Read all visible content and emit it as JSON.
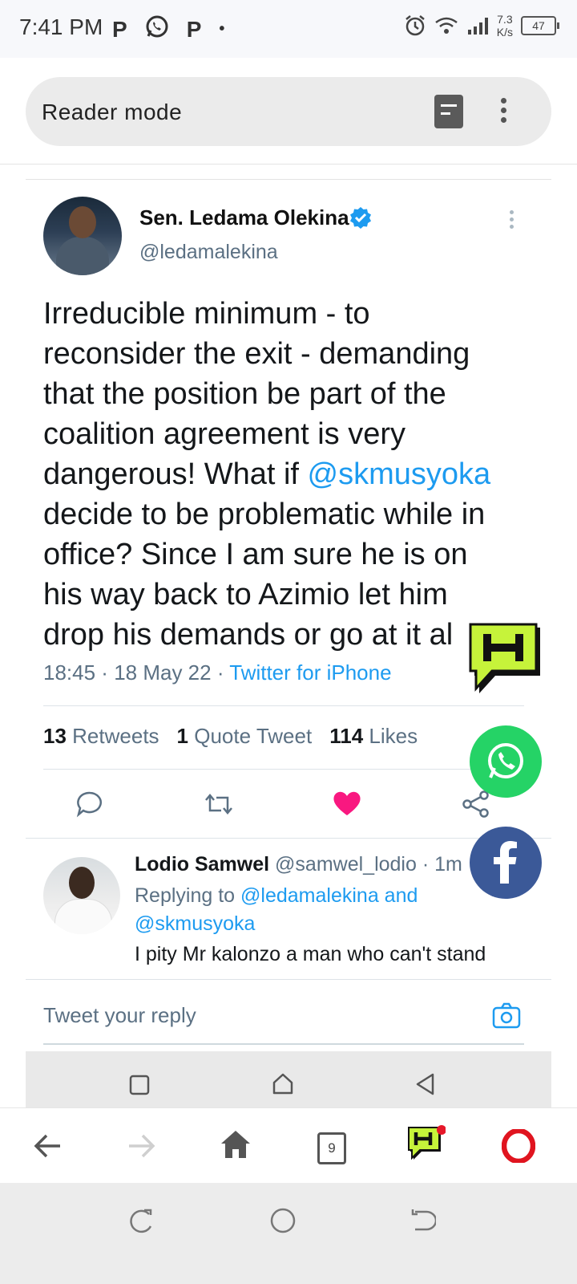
{
  "status_bar": {
    "time": "7:41 PM",
    "notification_icons": [
      "P",
      "whatsapp-icon",
      "P",
      "•"
    ],
    "net_speed_value": "7.3",
    "net_speed_unit": "K/s",
    "battery": "47"
  },
  "browser": {
    "reader_mode_label": "Reader mode",
    "tab_count": "9",
    "accent_color": "#1d9bf0"
  },
  "tweet": {
    "author_name": "Sen. Ledama Olekina",
    "author_handle": "@ledamalekina",
    "text_lines": [
      "Irreducible minimum - to",
      "reconsider the exit - demanding",
      "that the position be part of the",
      "coalition agreement is very",
      "dangerous! What if ",
      "decide to be problematic while in",
      "office? Since I am sure he is on",
      "his way back to Azimio let him",
      "drop his demands or go at it al"
    ],
    "mention": "@skmusyoka",
    "time": "18:45",
    "date": "18 May 22",
    "source": "Twitter for iPhone",
    "retweets_count": "13",
    "retweets_label": "Retweets",
    "quotes_count": "1",
    "quotes_label": "Quote Tweet",
    "likes_count": "114",
    "likes_label": "Likes"
  },
  "reply": {
    "author_name": "Lodio Samwel",
    "author_handle": "@samwel_lodio",
    "age": "· 1m",
    "replying_prefix": "Replying to ",
    "replying_to_1": "@ledamalekina",
    "replying_and": " and",
    "replying_to_2": "@skmusyoka",
    "text": "I pity Mr kalonzo a man who can't stand"
  },
  "reply_box": {
    "placeholder": "Tweet your reply"
  }
}
